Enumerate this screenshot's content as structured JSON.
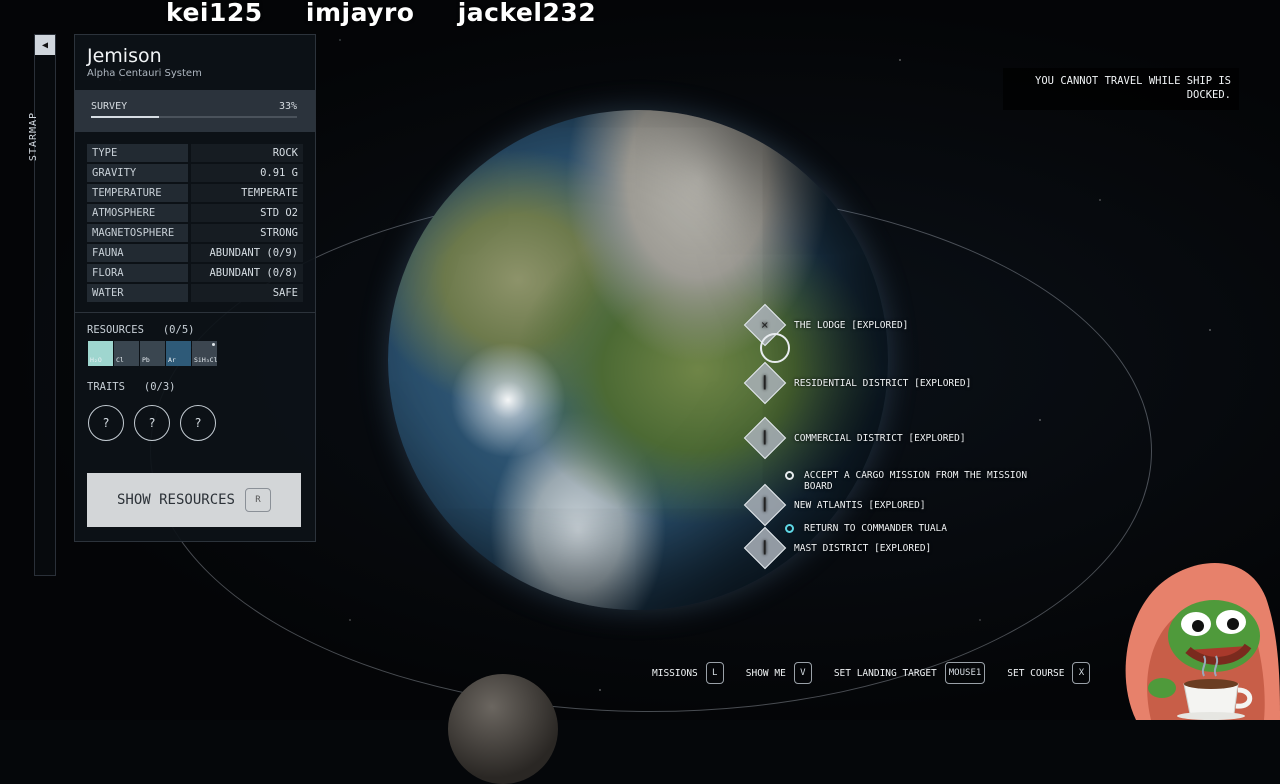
{
  "chat_names": [
    "kei125",
    "imjayro",
    "jackel232"
  ],
  "starmap": {
    "label": "STARMAP",
    "collapse_glyph": "◀"
  },
  "planet": {
    "name": "Jemison",
    "system": "Alpha Centauri System",
    "survey_label": "SURVEY",
    "survey_percent_text": "33%",
    "survey_fraction": 0.33
  },
  "stats": [
    {
      "key": "TYPE",
      "value": "ROCK"
    },
    {
      "key": "GRAVITY",
      "value": "0.91 G"
    },
    {
      "key": "TEMPERATURE",
      "value": "TEMPERATE"
    },
    {
      "key": "ATMOSPHERE",
      "value": "STD O2"
    },
    {
      "key": "MAGNETOSPHERE",
      "value": "STRONG"
    },
    {
      "key": "FAUNA",
      "value": "ABUNDANT (0/9)"
    },
    {
      "key": "FLORA",
      "value": "ABUNDANT (0/8)"
    },
    {
      "key": "WATER",
      "value": "SAFE"
    }
  ],
  "resources": {
    "header": "RESOURCES   (0/5)",
    "items": [
      {
        "symbol": "H₂O",
        "color": "#9fd6cf"
      },
      {
        "symbol": "Cl",
        "color": "#3a4650"
      },
      {
        "symbol": "Pb",
        "color": "#3a4650"
      },
      {
        "symbol": "Ar",
        "color": "#2e5a78"
      },
      {
        "symbol": "SiH₃Cl",
        "color": "#3c4650"
      }
    ]
  },
  "traits": {
    "header": "TRAITS   (0/3)",
    "items": [
      "?",
      "?",
      "?"
    ]
  },
  "show_resources": {
    "label": "SHOW RESOURCES",
    "key": "R"
  },
  "warning": "YOU CANNOT TRAVEL WHILE SHIP IS DOCKED.",
  "locations": [
    {
      "label": "THE LODGE [EXPLORED]",
      "glyph": "✕"
    },
    {
      "label": "RESIDENTIAL DISTRICT [EXPLORED]",
      "glyph": "┃"
    },
    {
      "label": "COMMERCIAL DISTRICT [EXPLORED]",
      "glyph": "┃"
    },
    {
      "label": "NEW ATLANTIS [EXPLORED]",
      "glyph": "┃"
    },
    {
      "label": "MAST DISTRICT [EXPLORED]",
      "glyph": "┃"
    }
  ],
  "missions": [
    {
      "label": "ACCEPT A CARGO MISSION FROM THE MISSION BOARD",
      "color": "#e8ecef"
    },
    {
      "label": "RETURN TO COMMANDER TUALA",
      "color": "#5fd8e6"
    }
  ],
  "controls": [
    {
      "label": "MISSIONS",
      "key": "L"
    },
    {
      "label": "SHOW ME",
      "key": "V"
    },
    {
      "label": "SET LANDING TARGET",
      "key": "MOUSE1"
    },
    {
      "label": "SET COURSE",
      "key": "X"
    }
  ]
}
